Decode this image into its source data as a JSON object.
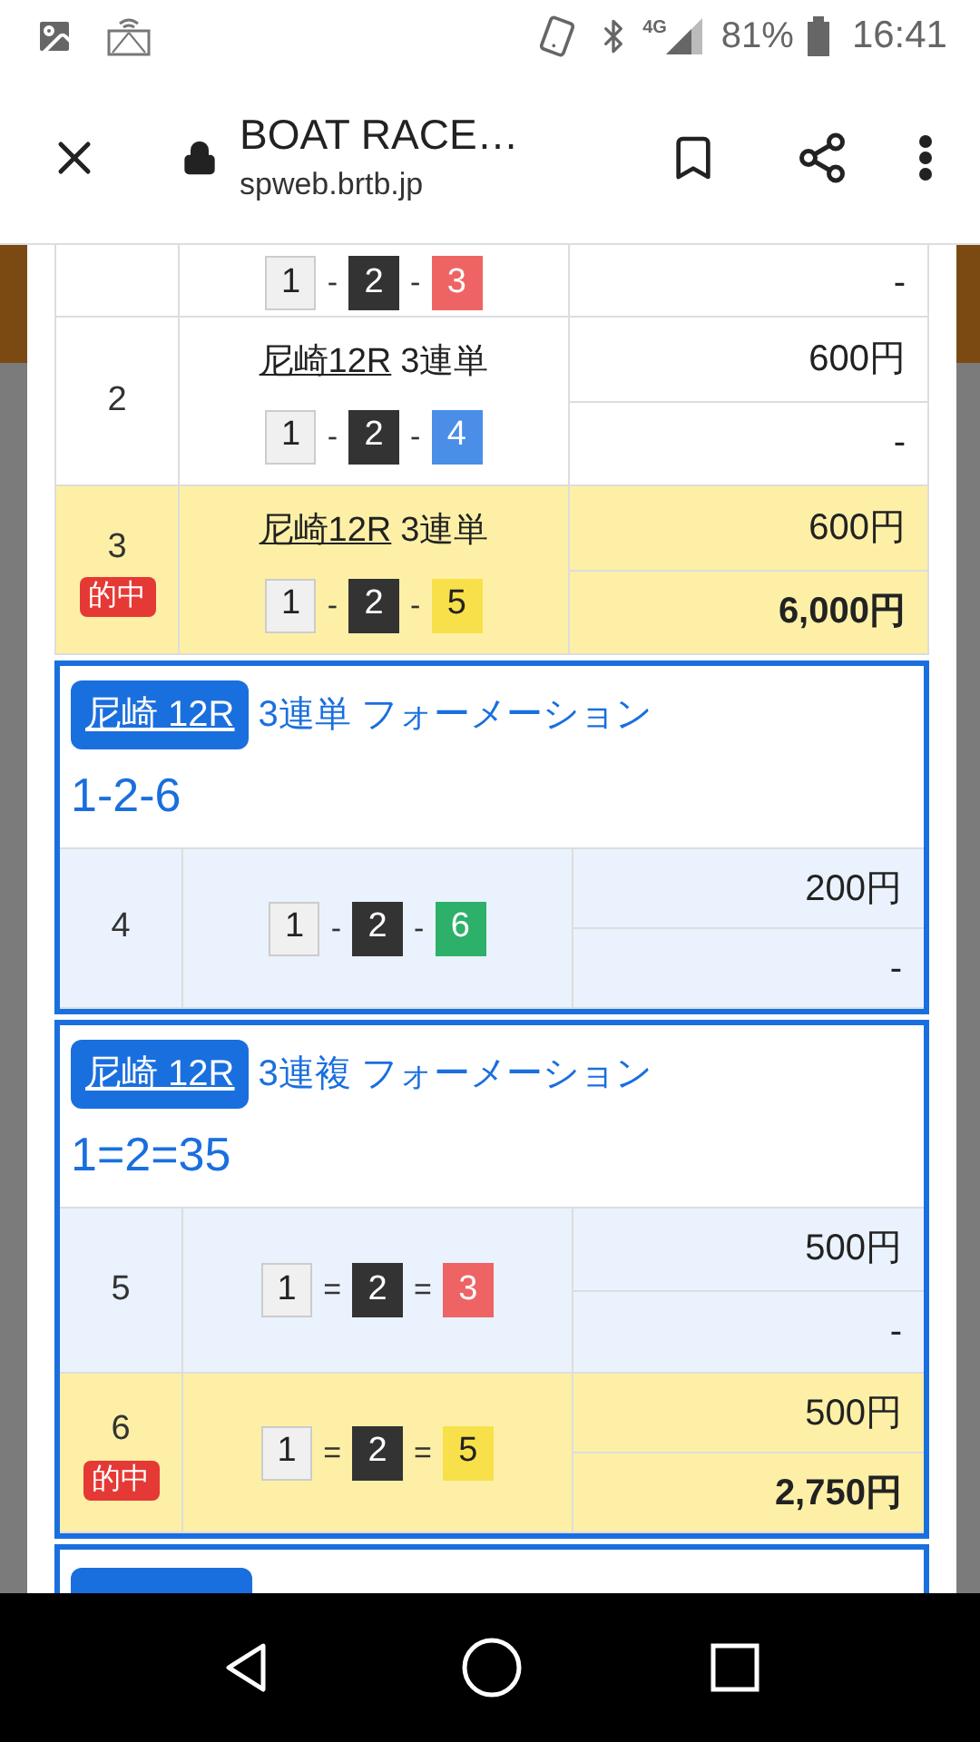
{
  "status_bar": {
    "network": "4G",
    "battery": "81%",
    "time": "16:41"
  },
  "toolbar": {
    "title": "BOAT RACE…",
    "url": "spweb.brtb.jp"
  },
  "groups": [
    {
      "kind": "plain",
      "rows": [
        {
          "hit": false,
          "combo": {
            "separator": "-",
            "boats": [
              {
                "number": "1",
                "color": "#f0f0f0"
              },
              {
                "number": "2",
                "color": "#333333"
              },
              {
                "number": "3",
                "color": "#ee6464"
              }
            ]
          },
          "payout": "-"
        },
        {
          "hit": false,
          "number": "2",
          "race_label": "尼崎12R",
          "bet_type": "3連単",
          "combo": {
            "separator": "-",
            "boats": [
              {
                "number": "1",
                "color": "#f0f0f0"
              },
              {
                "number": "2",
                "color": "#333333"
              },
              {
                "number": "4",
                "color": "#4a8ee8"
              }
            ]
          },
          "stake": "600円",
          "payout": "-"
        },
        {
          "hit": true,
          "badge": "的中",
          "number": "3",
          "race_label": "尼崎12R",
          "bet_type": "3連単",
          "combo": {
            "separator": "-",
            "boats": [
              {
                "number": "1",
                "color": "#f0f0f0"
              },
              {
                "number": "2",
                "color": "#333333"
              },
              {
                "number": "5",
                "color": "#f8e04a"
              }
            ]
          },
          "stake": "600円",
          "payout": "6,000円"
        }
      ]
    },
    {
      "kind": "formation",
      "race_chip": "尼崎 12R",
      "title": "3連単 フォーメーション",
      "formation": "1-2-6",
      "rows": [
        {
          "hit": false,
          "number": "4",
          "combo": {
            "separator": "-",
            "boats": [
              {
                "number": "1",
                "color": "#f0f0f0"
              },
              {
                "number": "2",
                "color": "#333333"
              },
              {
                "number": "6",
                "color": "#2db06a"
              }
            ]
          },
          "stake": "200円",
          "payout": "-"
        }
      ]
    },
    {
      "kind": "formation",
      "race_chip": "尼崎 12R",
      "title": "3連複 フォーメーション",
      "formation": "1=2=35",
      "rows": [
        {
          "hit": false,
          "number": "5",
          "combo": {
            "separator": "=",
            "boats": [
              {
                "number": "1",
                "color": "#f0f0f0"
              },
              {
                "number": "2",
                "color": "#333333"
              },
              {
                "number": "3",
                "color": "#ee6464"
              }
            ]
          },
          "stake": "500円",
          "payout": "-"
        },
        {
          "hit": true,
          "badge": "的中",
          "number": "6",
          "combo": {
            "separator": "=",
            "boats": [
              {
                "number": "1",
                "color": "#f0f0f0"
              },
              {
                "number": "2",
                "color": "#333333"
              },
              {
                "number": "5",
                "color": "#f8e04a"
              }
            ]
          },
          "stake": "500円",
          "payout": "2,750円"
        }
      ]
    },
    {
      "kind": "cut"
    }
  ]
}
